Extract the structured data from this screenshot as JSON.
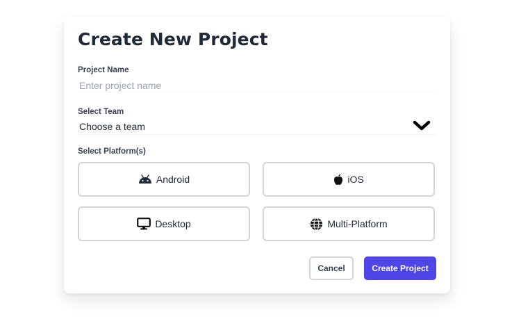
{
  "form": {
    "title": "Create New Project",
    "project_name": {
      "label": "Project Name",
      "placeholder": "Enter project name",
      "value": ""
    },
    "team": {
      "label": "Select Team",
      "selected": "Choose a team"
    },
    "platforms_label": "Select Platform(s)",
    "platforms": [
      {
        "label": "Android",
        "icon": "android-icon"
      },
      {
        "label": "iOS",
        "icon": "apple-icon"
      },
      {
        "label": "Desktop",
        "icon": "desktop-icon"
      },
      {
        "label": "Multi-Platform",
        "icon": "globe-icon"
      }
    ],
    "cancel_label": "Cancel",
    "create_label": "Create Project"
  },
  "colors": {
    "primary": "#4f46e5",
    "border": "#d1d5db",
    "text": "#1f2937",
    "placeholder": "#9ca3af"
  }
}
